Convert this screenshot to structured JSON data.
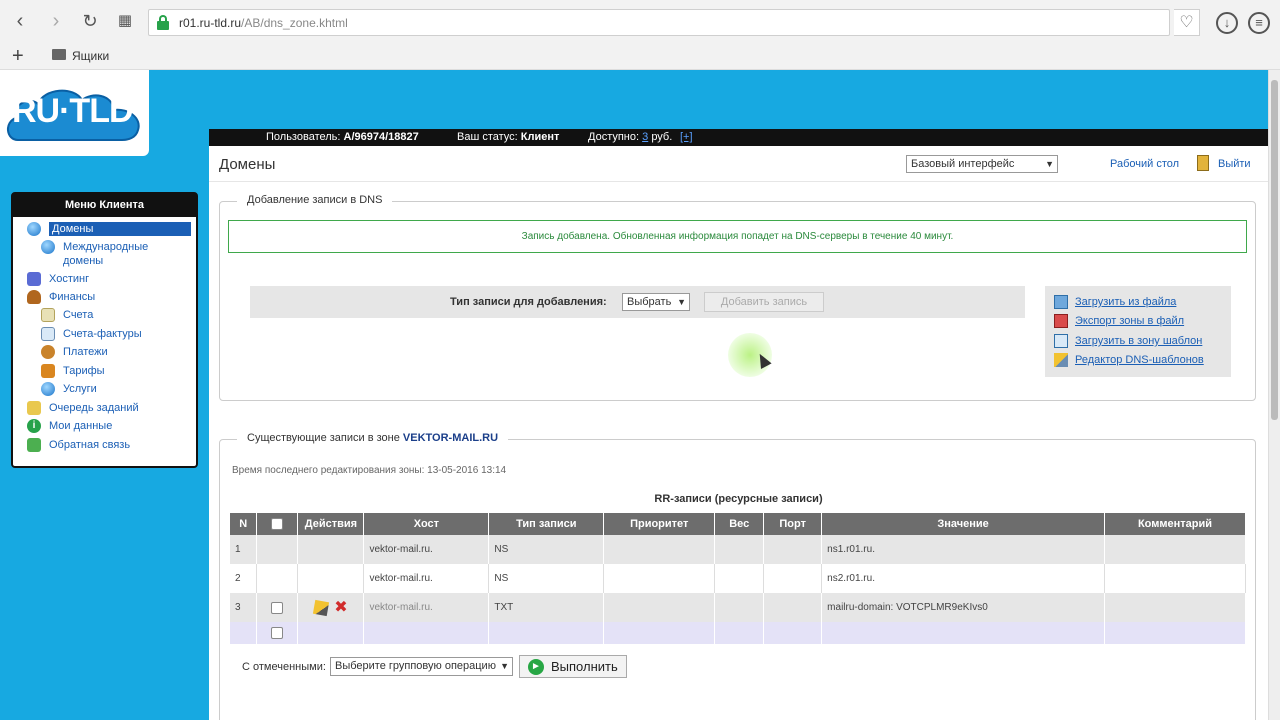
{
  "browser": {
    "url_host": "r01.ru-tld.ru",
    "url_path": "/AB/dns_zone.khtml",
    "bookmark_folder": "Ящики"
  },
  "userbar": {
    "user_label": "Пользователь:",
    "user_value": "A/96974/18827",
    "status_label": "Ваш статус:",
    "status_value": "Клиент",
    "available_label": "Доступно:",
    "available_value": "3",
    "currency": "руб.",
    "plus": "[+]"
  },
  "header": {
    "page_title": "Домены",
    "interface_select": "Базовый интерфейс",
    "desktop_link": "Рабочий стол",
    "exit_link": "Выйти"
  },
  "menu": {
    "title": "Меню Клиента",
    "items": [
      {
        "label": "Домены",
        "icon": "globe-icon"
      },
      {
        "label": "Международные домены",
        "icon": "globe-icon"
      },
      {
        "label": "Хостинг",
        "icon": "book-icon"
      },
      {
        "label": "Финансы",
        "icon": "bag-icon"
      },
      {
        "label": "Счета",
        "icon": "document-icon"
      },
      {
        "label": "Счета-фактуры",
        "icon": "documents-icon"
      },
      {
        "label": "Платежи",
        "icon": "coins-icon"
      },
      {
        "label": "Тарифы",
        "icon": "briefcase-icon"
      },
      {
        "label": "Услуги",
        "icon": "globe-icon"
      },
      {
        "label": "Очередь заданий",
        "icon": "queue-icon"
      },
      {
        "label": "Мои данные",
        "icon": "info-icon"
      },
      {
        "label": "Обратная связь",
        "icon": "mail-icon"
      }
    ]
  },
  "add_record": {
    "legend": "Добавление записи в DNS",
    "notice": "Запись добавлена. Обновленная информация попадет на DNS-серверы в течение 40 минут.",
    "type_label": "Тип записи для добавления:",
    "type_select": "Выбрать",
    "add_button": "Добавить запись",
    "tools": [
      "Загрузить из файла",
      "Экспорт зоны в файл",
      "Загрузить в зону шаблон",
      "Редактор DNS-шаблонов"
    ]
  },
  "existing": {
    "legend_prefix": "Существующие записи в зоне",
    "zone": "VEKTOR-MAIL.RU",
    "edit_time": "Время последнего редактирования зоны: 13-05-2016 13:14",
    "table_title": "RR-записи (ресурсные записи)",
    "columns": [
      "N",
      "",
      "Действия",
      "Хост",
      "Тип записи",
      "Приоритет",
      "Вес",
      "Порт",
      "Значение",
      "Комментарий"
    ],
    "rows": [
      {
        "n": "1",
        "host": "vektor-mail.ru.",
        "type": "NS",
        "value": "ns1.r01.ru."
      },
      {
        "n": "2",
        "host": "vektor-mail.ru.",
        "type": "NS",
        "value": "ns2.r01.ru."
      },
      {
        "n": "3",
        "host": "vektor-mail.ru.",
        "type": "TXT",
        "value": "mailru-domain: VOTCPLMR9eKIvs0"
      }
    ],
    "group_label": "С отмеченными:",
    "group_select": "Выберите групповую операцию",
    "execute_button": "Выполнить"
  }
}
